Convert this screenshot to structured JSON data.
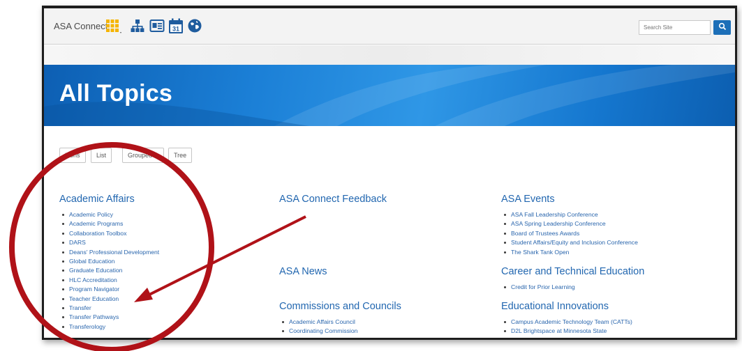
{
  "header": {
    "brand": "ASA Connect",
    "icons": [
      "apps-grid-icon",
      "sitemap-icon",
      "id-card-icon",
      "calendar-icon",
      "globe-icon"
    ],
    "calendar_day": "31",
    "search_placeholder": "Search Site",
    "search_icon": "search-icon"
  },
  "banner": {
    "title": "All Topics"
  },
  "views": [
    {
      "label": "Icons"
    },
    {
      "label": "List"
    },
    {
      "label": "Grouped"
    },
    {
      "label": "Tree"
    }
  ],
  "columns": [
    {
      "groups": [
        {
          "title": "Academic Affairs",
          "items": [
            "Academic Policy",
            "Academic Programs",
            "Collaboration Toolbox",
            "DARS",
            "Deans' Professional Development",
            "Global Education",
            "Graduate Education",
            "HLC Accreditation",
            "Program Navigator",
            "Teacher Education",
            "Transfer",
            "Transfer Pathways",
            "Transferology"
          ]
        }
      ]
    },
    {
      "groups": [
        {
          "title": "ASA Connect Feedback",
          "items": []
        },
        {
          "title": "ASA News",
          "items": []
        },
        {
          "title": "Commissions and Councils",
          "items": [
            "Academic Affairs Council",
            "Coordinating Commission"
          ]
        }
      ]
    },
    {
      "groups": [
        {
          "title": "ASA Events",
          "items": [
            "ASA Fall Leadership Conference",
            "ASA Spring Leadership Conference",
            "Board of Trustees Awards",
            "Student Affairs/Equity and Inclusion Conference",
            "The Shark Tank Open"
          ]
        },
        {
          "title": "Career and Technical Education",
          "items": [
            "Credit for Prior Learning"
          ]
        },
        {
          "title": "Educational Innovations",
          "items": [
            "Campus Academic Technology Team (CATTs)",
            "D2L Brightspace at Minnesota State"
          ]
        }
      ]
    }
  ],
  "annotation": {
    "color": "#b01218",
    "shapes": [
      "circle-highlight",
      "arrow-pointer"
    ]
  },
  "colors": {
    "accent": "#1d6fb8",
    "link": "#2a66ad",
    "heading": "#2267b0",
    "apps_icon": "#f5b400",
    "toolbar_icon": "#1f5c9e"
  }
}
